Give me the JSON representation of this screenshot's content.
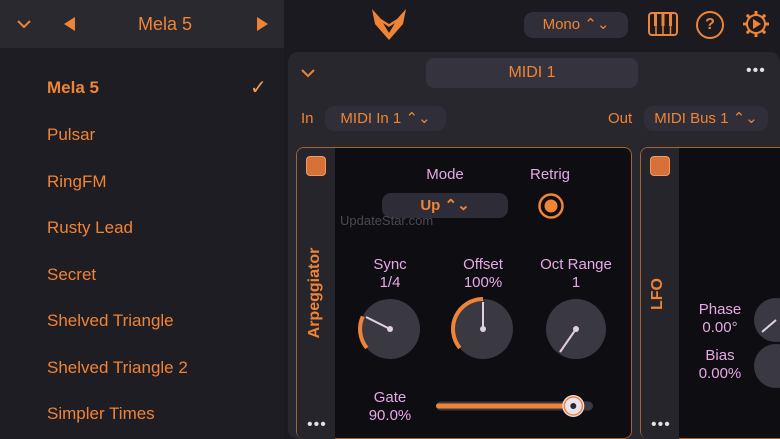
{
  "preset_header": {
    "prev_icon": "triangle-left-icon",
    "next_icon": "triangle-right-icon",
    "current": "Mela 5"
  },
  "preset_list": [
    {
      "label": "Mela 5",
      "selected": true
    },
    {
      "label": "Pulsar"
    },
    {
      "label": "RingFM"
    },
    {
      "label": "Rusty Lead"
    },
    {
      "label": "Secret"
    },
    {
      "label": "Shelved Triangle"
    },
    {
      "label": "Shelved Triangle 2"
    },
    {
      "label": "Simpler Times"
    }
  ],
  "topbar": {
    "voice_mode": "Mono ⌃⌄"
  },
  "midi": {
    "title": "MIDI 1",
    "in_label": "In",
    "in_value": "MIDI In 1 ⌃⌄",
    "out_label": "Out",
    "out_value": "MIDI Bus 1 ⌃⌄",
    "more": "•••"
  },
  "arpeggiator": {
    "name": "Arpeggiator",
    "mode_label": "Mode",
    "mode_value": "Up ⌃⌄",
    "retrig_label": "Retrig",
    "watermark": "UpdateStar.com",
    "sync_label": "Sync",
    "sync_value": "1/4",
    "offset_label": "Offset",
    "offset_value": "100%",
    "oct_label": "Oct Range",
    "oct_value": "1",
    "gate_label": "Gate",
    "gate_value": "90.0%",
    "gate_fraction": 0.9,
    "more": "•••"
  },
  "lfo": {
    "name": "LFO",
    "phase_label": "Phase",
    "phase_value": "0.00°",
    "bias_label": "Bias",
    "bias_value": "0.00%",
    "more": "•••"
  },
  "colors": {
    "accent": "#f08436",
    "knob_label": "#e7a9e6",
    "panel_border": "#a6622f"
  }
}
